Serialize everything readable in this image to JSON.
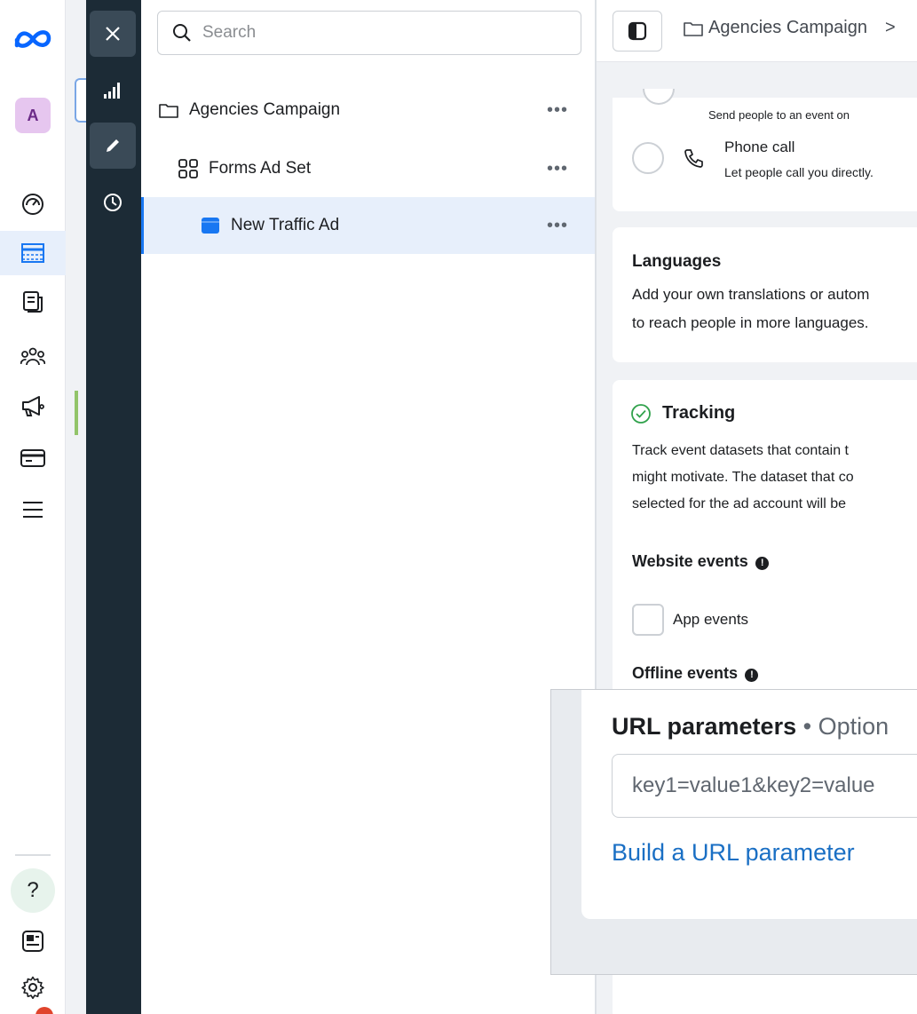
{
  "nav_rail": {
    "account_initial": "A",
    "items": [
      {
        "icon": "dashboard-gauge-icon"
      },
      {
        "icon": "ads-manager-table-icon",
        "active": true
      },
      {
        "icon": "pages-icon"
      },
      {
        "icon": "audiences-icon"
      },
      {
        "icon": "campaign-megaphone-icon"
      },
      {
        "icon": "billing-card-icon"
      },
      {
        "icon": "menu-icon"
      }
    ],
    "help_label": "?"
  },
  "tool_column": {
    "items": [
      "close-icon",
      "chart-bars-icon",
      "edit-pencil-icon",
      "history-clock-icon"
    ]
  },
  "tree": {
    "search_placeholder": "Search",
    "items": [
      {
        "label": "Agencies Campaign",
        "level": "campaign",
        "more": "•••"
      },
      {
        "label": "Forms Ad Set",
        "level": "ad-set",
        "more": "•••"
      },
      {
        "label": "New Traffic Ad",
        "level": "ad",
        "more": "•••",
        "selected": true
      }
    ]
  },
  "editor": {
    "breadcrumb": "Agencies Campaign",
    "breadcrumb_sep": ">",
    "partial_option_desc": "Send people to an event on",
    "phone_call": {
      "title": "Phone call",
      "desc": "Let people call you directly."
    },
    "languages": {
      "title": "Languages",
      "line1": "Add your own translations or autom",
      "line2": "to reach people in more languages."
    },
    "tracking": {
      "title": "Tracking",
      "line1": "Track event datasets that contain t",
      "line2": "might motivate. The dataset that co",
      "line3": "selected for the ad account will be",
      "website_events": "Website events",
      "app_events": "App events",
      "offline_events": "Offline events"
    }
  },
  "callout": {
    "title": "URL parameters",
    "title_suffix": "• Option",
    "input_placeholder": "key1=value1&key2=value",
    "link": "Build a URL parameter"
  },
  "colors": {
    "accent": "#1877f2",
    "link": "#1a6fc4",
    "tool_column_bg": "#1c2b36",
    "success_green": "#31a24c"
  }
}
